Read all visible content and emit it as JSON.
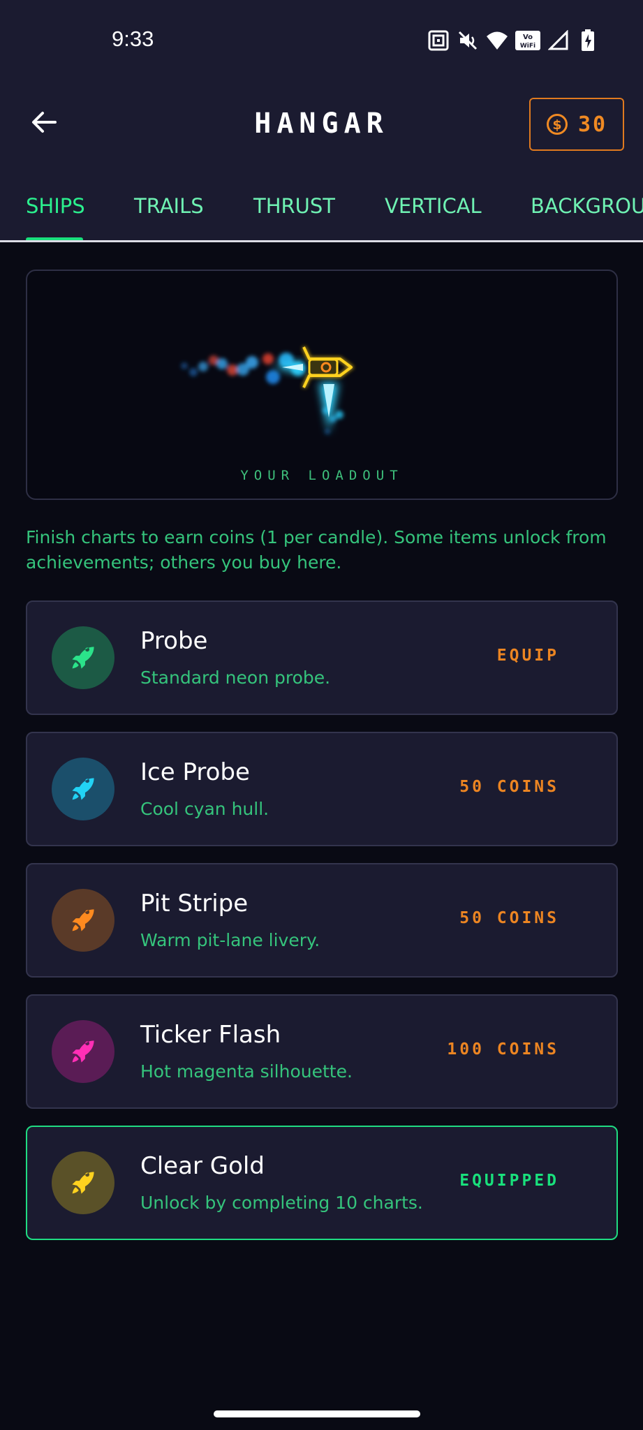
{
  "status_bar": {
    "time": "9:33",
    "icons": [
      "nfc-icon",
      "mute-icon",
      "wifi-icon",
      "vowifi-icon",
      "signal-icon",
      "battery-charging-icon"
    ],
    "vowifi_label": "Vo WiFi"
  },
  "header": {
    "title": "HANGAR",
    "coins": "30"
  },
  "tabs": [
    {
      "label": "SHIPS",
      "active": true
    },
    {
      "label": "TRAILS",
      "active": false
    },
    {
      "label": "THRUST",
      "active": false
    },
    {
      "label": "VERTICAL",
      "active": false
    },
    {
      "label": "BACKGROUND",
      "active": false
    }
  ],
  "preview": {
    "label": "YOUR LOADOUT"
  },
  "info_text": "Finish charts to earn coins (1 per candle). Some items unlock from achievements; others you buy here.",
  "items": [
    {
      "name": "Probe",
      "desc": "Standard neon probe.",
      "action": "EQUIP",
      "color": "#2be38a",
      "bg": "#1c5a45"
    },
    {
      "name": "Ice Probe",
      "desc": "Cool cyan hull.",
      "action": "50 COINS",
      "color": "#22d3f5",
      "bg": "#1b4f6b"
    },
    {
      "name": "Pit Stripe",
      "desc": "Warm pit-lane livery.",
      "action": "50 COINS",
      "color": "#ff8a1f",
      "bg": "#5a3a28"
    },
    {
      "name": "Ticker Flash",
      "desc": "Hot magenta silhouette.",
      "action": "100 COINS",
      "color": "#ff2fb6",
      "bg": "#5a1c55"
    },
    {
      "name": "Clear Gold",
      "desc": "Unlock by completing 10 charts.",
      "action": "EQUIPPED",
      "color": "#ffd21f",
      "bg": "#5a5128",
      "equipped": true
    }
  ],
  "colors": {
    "accent_green": "#19e07c",
    "accent_orange": "#ec8522",
    "card_bg": "#1b1b30",
    "page_bg": "#090a14"
  }
}
